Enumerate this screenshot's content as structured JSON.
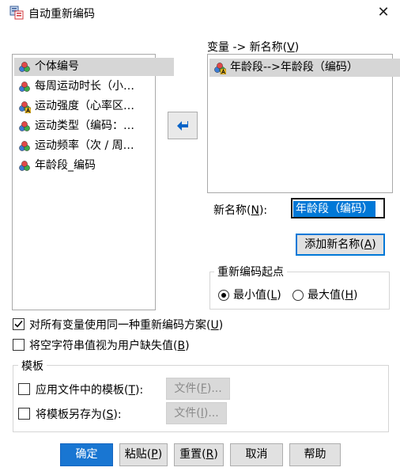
{
  "window": {
    "title": "自动重新编码",
    "close_glyph": "✕"
  },
  "source_list": {
    "items": [
      {
        "label": "个体编号",
        "icon": "nominal-var-icon",
        "selected": true
      },
      {
        "label": "每周运动时长（小…",
        "icon": "nominal-var-icon",
        "selected": false
      },
      {
        "label": "运动强度（心率区…",
        "icon": "string-var-icon",
        "selected": false
      },
      {
        "label": "运动类型（编码：…",
        "icon": "nominal-var-icon",
        "selected": false
      },
      {
        "label": "运动频率（次 / 周…",
        "icon": "nominal-var-icon",
        "selected": false
      },
      {
        "label": "年龄段_编码",
        "icon": "nominal-var-icon",
        "selected": false
      }
    ]
  },
  "mapping": {
    "heading_prefix": "变量 -> 新名称(",
    "heading_key": "V",
    "heading_suffix": ")",
    "items": [
      {
        "label": "年龄段-->年龄段（编码）",
        "icon": "string-var-icon",
        "selected": true
      }
    ]
  },
  "new_name": {
    "label_prefix": "新名称(",
    "label_key": "N",
    "label_suffix": "):",
    "value": "年龄段（编码）"
  },
  "add_button": {
    "prefix": "添加新名称(",
    "key": "A",
    "suffix": ")"
  },
  "recode_start": {
    "title": "重新编码起点",
    "min": {
      "prefix": "最小值(",
      "key": "L",
      "suffix": ")",
      "selected": true
    },
    "max": {
      "prefix": "最大值(",
      "key": "H",
      "suffix": ")",
      "selected": false
    }
  },
  "options": {
    "same_scheme": {
      "prefix": "对所有变量使用同一种重新编码方案(",
      "key": "U",
      "suffix": ")",
      "checked": true
    },
    "blank_missing": {
      "prefix": "将空字符串值视为用户缺失值(",
      "key": "B",
      "suffix": ")",
      "checked": false
    }
  },
  "template": {
    "title": "模板",
    "apply": {
      "prefix": "应用文件中的模板(",
      "key": "T",
      "suffix": "):",
      "checked": false,
      "file_btn": {
        "prefix": "文件(",
        "key": "F",
        "suffix": ")..."
      }
    },
    "save_as": {
      "prefix": "将模板另存为(",
      "key": "S",
      "suffix": "):",
      "checked": false,
      "file_btn": {
        "prefix": "文件(",
        "key": "I",
        "suffix": ")..."
      }
    }
  },
  "footer": {
    "ok": "确定",
    "paste": {
      "prefix": "粘贴(",
      "key": "P",
      "suffix": ")"
    },
    "reset": {
      "prefix": "重置(",
      "key": "R",
      "suffix": ")"
    },
    "cancel": "取消",
    "help": "帮助"
  },
  "colors": {
    "accent": "#0078d7",
    "primary_button": "#1976d2",
    "selection": "#d6d6d6"
  }
}
